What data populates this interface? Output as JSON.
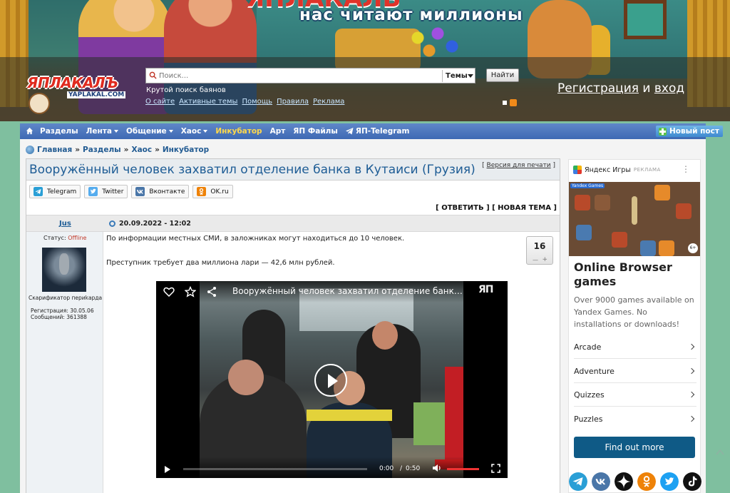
{
  "banner": {
    "title_partial": "ЯПЛАКАЛЬ",
    "tagline": "нас читают миллионы"
  },
  "logo": {
    "text": "ЯПЛАКАЛЪ",
    "domain": "YAPLAKAL.COM"
  },
  "search": {
    "placeholder": "Поиск...",
    "scope": "Темы",
    "button": "Найти",
    "hint": "Крутой поиск баянов"
  },
  "toplinks": [
    "О сайте",
    "Активные темы",
    "Помощь",
    "Правила",
    "Реклама"
  ],
  "auth": {
    "register": "Регистрация",
    "and": "и",
    "login": "вход"
  },
  "nav": {
    "items": [
      {
        "label": "Разделы",
        "caret": false
      },
      {
        "label": "Лента",
        "caret": true
      },
      {
        "label": "Общение",
        "caret": true
      },
      {
        "label": "Хаос",
        "caret": true
      },
      {
        "label": "Инкубатор",
        "caret": false
      },
      {
        "label": "Арт",
        "caret": false
      },
      {
        "label": "ЯП Файлы",
        "caret": false
      },
      {
        "label": "ЯП-Telegram",
        "caret": false
      }
    ],
    "new_post": "Новый пост"
  },
  "breadcrumb": [
    "Главная",
    "Разделы",
    "Хаос",
    "Инкубатор"
  ],
  "topic": {
    "title": "Вооружённый человек захватил отделение банка в Кутаиси (Грузия)",
    "print": "Версия для печати",
    "reply": "[ ОТВЕТИТЬ ] [ НОВАЯ ТЕМА ]"
  },
  "share": [
    {
      "label": "Telegram",
      "icon": "telegram-icon",
      "color": "#2a9fd6"
    },
    {
      "label": "Twitter",
      "icon": "twitter-icon",
      "color": "#55acee"
    },
    {
      "label": "Вконтакте",
      "icon": "vk-icon",
      "color": "#4a76a8"
    },
    {
      "label": "OK.ru",
      "icon": "ok-icon",
      "color": "#ee8208"
    }
  ],
  "post": {
    "author": "Jus",
    "date": "20.09.2022 - 12:02",
    "status_label": "Статус:",
    "status_value": "Offline",
    "rank": "Скарификатор периkарда",
    "registration": "Регистрация: 30.05.06",
    "messages": "Сообщений: 361388",
    "p1": "По информации местных СМИ, в заложниках могут находиться до 10 человек.",
    "p2": "Преступник требует два миллиона лари — 42,6 млн рублей.",
    "rating": "16",
    "rating_minus": "—",
    "rating_plus": "+"
  },
  "video": {
    "title": "Вооружённый человек захватил отделение банка в Кутаиси (Грузия)",
    "brand": "ЯП",
    "current": "0:00",
    "separator": "/",
    "duration": "0:50"
  },
  "ad": {
    "source": "Яндекс Игры",
    "tag": "РЕКЛАМА",
    "image_badge": "Yandex Games",
    "age": "6+",
    "title": "Online Browser games",
    "desc": "Over 9000 games available on Yandex Games. No installations or downloads!",
    "categories": [
      "Arcade",
      "Adventure",
      "Quizzes",
      "Puzzles"
    ],
    "cta": "Find out more"
  },
  "socials": [
    {
      "icon": "telegram-icon",
      "color": "#2a9fd6"
    },
    {
      "icon": "vk-icon",
      "color": "#4a76a8"
    },
    {
      "icon": "zen-icon",
      "color": "#111111"
    },
    {
      "icon": "ok-icon",
      "color": "#ee8208"
    },
    {
      "icon": "twitter-icon",
      "color": "#1da1f2"
    },
    {
      "icon": "tiktok-icon",
      "color": "#111111"
    }
  ],
  "colors": {
    "accent": "#3e69b4",
    "link": "#1d5c95",
    "offline": "#c23a2a",
    "cta": "#0f5a86"
  }
}
